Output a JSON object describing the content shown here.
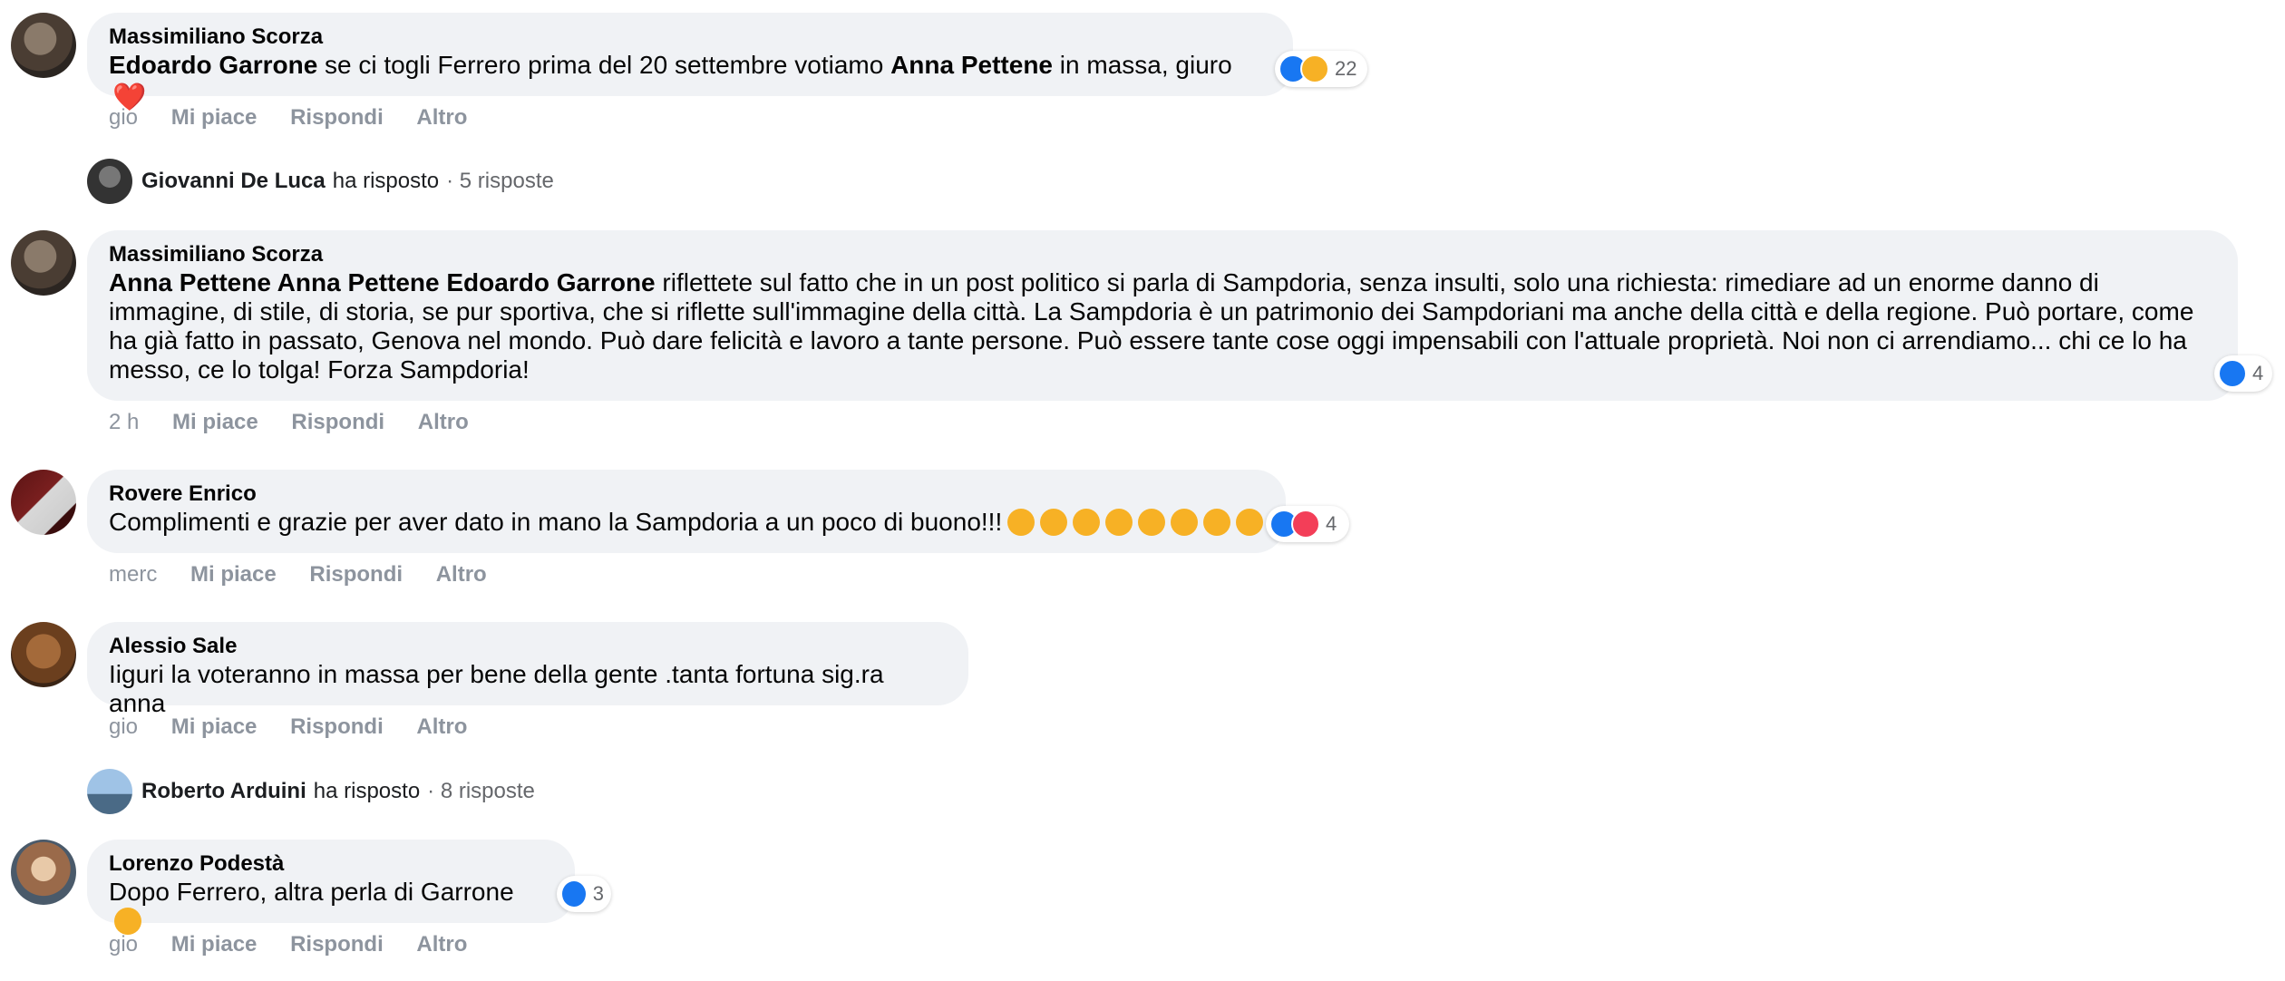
{
  "comments": [
    {
      "author": "Massimiliano Scorza",
      "text_parts": [
        "Edoardo Garrone",
        " se ci togli Ferrero prima del 20 settembre votiamo ",
        "Anna Pettene",
        " in massa, giuro "
      ],
      "heart": "❤️",
      "reactions_count": "22",
      "time": "gio",
      "like": "Mi piace",
      "reply": "Rispondi",
      "more": "Altro",
      "reply_summary": {
        "name": "Giovanni De Luca",
        "verb": "ha risposto",
        "count": "· 5 risposte"
      }
    },
    {
      "author": "Massimiliano Scorza",
      "mentions": "Anna Pettene Anna Pettene Edoardo Garrone",
      "line1": " riflettete sul fatto che in un post politico si parla di Sampdoria, senza insulti, solo una richiesta: rimediare ad un enorme danno di",
      "line2": "immagine, di stile, di storia, se pur sportiva, che si riflette sull'immagine della città. La Sampdoria è un patrimonio dei Sampdoriani ma anche della città e della regione. Può portare, come",
      "line3": "ha già fatto in passato, Genova nel mondo. Può dare felicità e lavoro a tante persone. Può essere tante cose oggi impensabili con l'attuale proprietà. Noi non ci arrendiamo... chi ce lo ha",
      "line4": "messo, ce lo tolga! Forza Sampdoria!",
      "reactions_count": "4",
      "time": "2 h",
      "like": "Mi piace",
      "reply": "Rispondi",
      "more": "Altro"
    },
    {
      "author": "Rovere Enrico",
      "text": "Complimenti e grazie per aver dato in mano la Sampdoria a un poco di buono!!!",
      "emoji_count": 8,
      "reactions_count": "4",
      "time": "merc",
      "like": "Mi piace",
      "reply": "Rispondi",
      "more": "Altro"
    },
    {
      "author": "Alessio Sale",
      "text": "Iiguri la voteranno in massa per bene della gente .tanta fortuna sig.ra anna",
      "time": "gio",
      "like": "Mi piace",
      "reply": "Rispondi",
      "more": "Altro",
      "reply_summary": {
        "name": "Roberto Arduini",
        "verb": "ha risposto",
        "count": "· 8 risposte"
      }
    },
    {
      "author": "Lorenzo Podestà",
      "text": "Dopo Ferrero, altra perla di Garrone ",
      "reactions_count": "3",
      "time": "gio",
      "like": "Mi piace",
      "reply": "Rispondi",
      "more": "Altro"
    }
  ],
  "colors": {
    "like": "#1877f2",
    "haha": "#f7b125",
    "love": "#f33e58",
    "bubble": "#f0f2f5",
    "meta": "#8d949e"
  }
}
